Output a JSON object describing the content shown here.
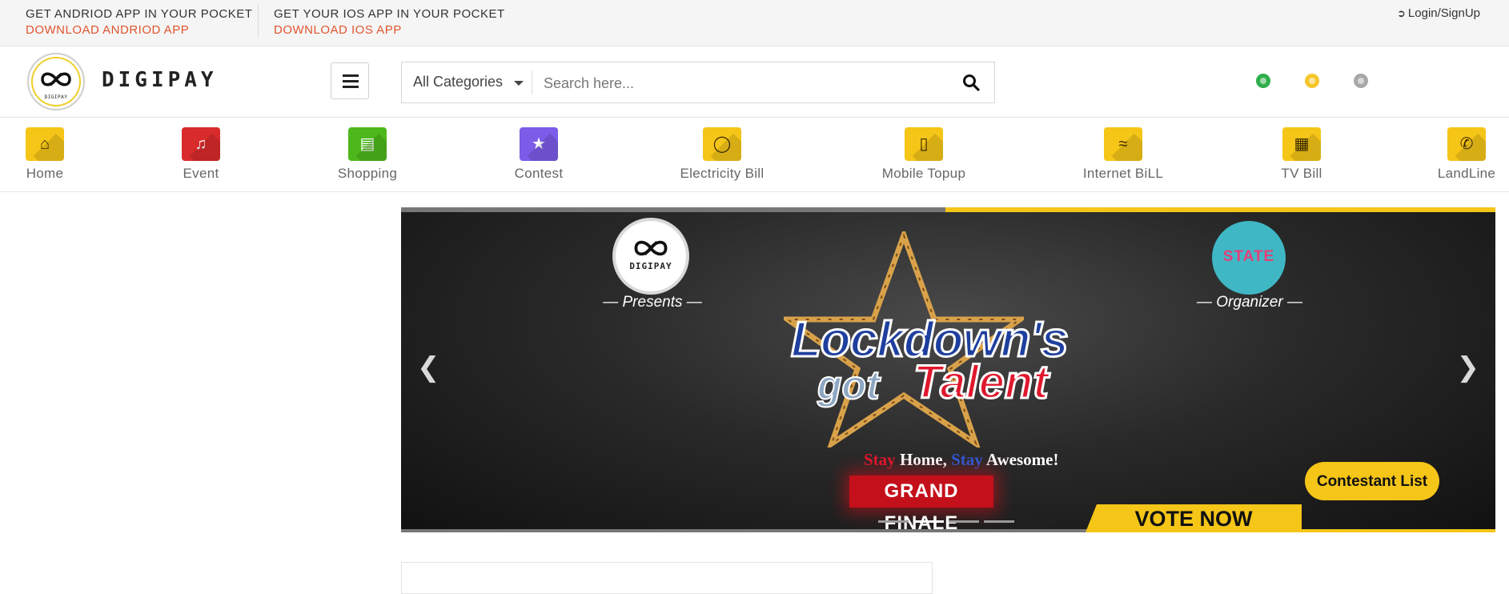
{
  "topbar": {
    "android_line1": "GET ANDRIOD APP IN YOUR POCKET",
    "android_line2": "DOWNLOAD ANDRIOD APP",
    "ios_line1": "GET YOUR IOS APP IN YOUR POCKET",
    "ios_line2": "DOWNLOAD IOS APP",
    "login_label": "Login/SignUp"
  },
  "header": {
    "brand": "DIGIPAY",
    "logo_small_text": "DIGIPAY",
    "category_selected": "All Categories",
    "search_placeholder": "Search here...",
    "icons": [
      "currency-icon",
      "coin-icon",
      "settings-icon"
    ]
  },
  "catnav": {
    "items": [
      {
        "label": "Home",
        "color": "#f5c518",
        "icon": "home-icon"
      },
      {
        "label": "Event",
        "color": "#d92b2b",
        "icon": "music-icon"
      },
      {
        "label": "Shopping",
        "color": "#4db81c",
        "icon": "basket-icon"
      },
      {
        "label": "Contest",
        "color": "#7b5ce8",
        "icon": "trophy-icon"
      },
      {
        "label": "Electricity Bill",
        "color": "#f5c518",
        "icon": "bulb-icon"
      },
      {
        "label": "Mobile Topup",
        "color": "#f5c518",
        "icon": "mobile-icon"
      },
      {
        "label": "Internet BiLL",
        "color": "#f5c518",
        "icon": "wifi-icon"
      },
      {
        "label": "TV Bill",
        "color": "#f5c518",
        "icon": "calendar-icon"
      },
      {
        "label": "LandLine",
        "color": "#f5c518",
        "icon": "phone-icon"
      }
    ]
  },
  "slider": {
    "logo_text": "DIGIPAY",
    "presents": "— Presents —",
    "organizer_logo_text": "STATE",
    "organizer": "— Organizer —",
    "title_line1": "Lockdown's",
    "title_line2a": "got",
    "title_line2b": "Talent",
    "tagline_stay1": "Stay",
    "tagline_home": " Home, ",
    "tagline_stay2": "Stay",
    "tagline_awesome": " Awesome!",
    "grand_finale": "GRAND FINALE",
    "vote_now": "VOTE NOW",
    "contestant_button": "Contestant List",
    "dots_total": 4,
    "active_dot": 2
  }
}
